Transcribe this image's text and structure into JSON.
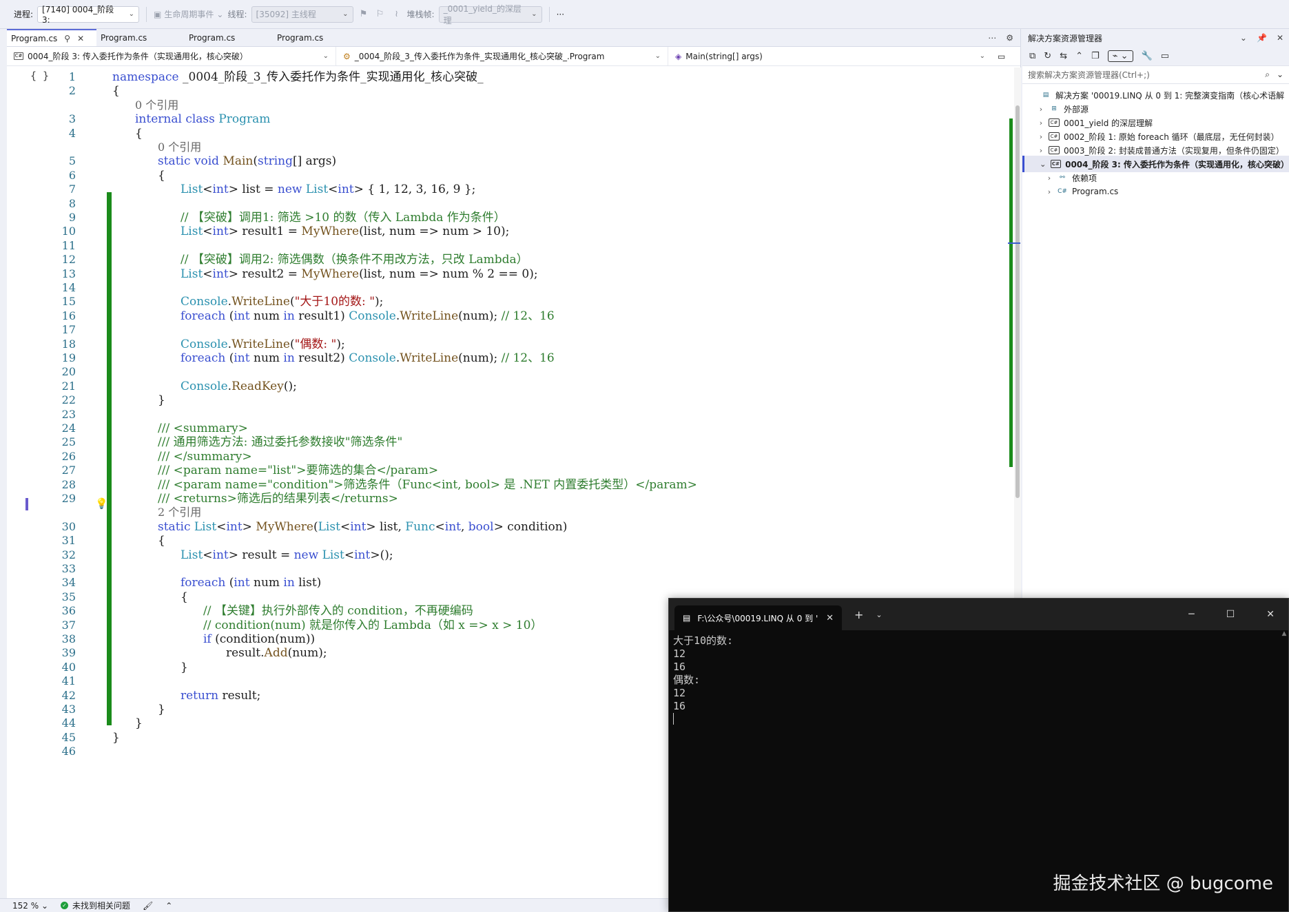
{
  "toolbar": {
    "process_label": "进程:",
    "process_value": "[7140] 0004_阶段 3:",
    "lifecycle_label": "生命周期事件",
    "thread_label": "线程:",
    "thread_value": "[35092] 主线程",
    "stackframe_label": "堆栈帧:",
    "stackframe_value": "_0001_yield_的深层理",
    "more": "···"
  },
  "tabs": [
    {
      "label": "Program.cs",
      "pin": "⚲",
      "close": "✕"
    },
    {
      "label": "Program.cs"
    },
    {
      "label": "Program.cs"
    },
    {
      "label": "Program.cs"
    }
  ],
  "navbar": {
    "project": "0004_阶段 3: 传入委托作为条件（实现通用化，核心突破）",
    "class": "_0004_阶段_3_传入委托作为条件_实现通用化_核心突破_.Program",
    "member": "Main(string[] args)"
  },
  "code_lines": [
    {
      "n": "1",
      "html": "<span class=\"kw\">namespace</span> _0004_阶段_3_传入委托作为条件_实现通用化_核心突破_",
      "indent": 0
    },
    {
      "n": "2",
      "html": "{",
      "indent": 0
    },
    {
      "n": "",
      "html": "<span class=\"ref\">0 个引用</span>",
      "indent": 1
    },
    {
      "n": "3",
      "html": "<span class=\"kw\">internal class</span> <span class=\"ty\">Program</span>",
      "indent": 1
    },
    {
      "n": "4",
      "html": "{",
      "indent": 1
    },
    {
      "n": "",
      "html": "<span class=\"ref\">0 个引用</span>",
      "indent": 2
    },
    {
      "n": "5",
      "html": "<span class=\"kw\">static void</span> <span class=\"mt\">Main</span>(<span class=\"kw\">string</span>[] args)",
      "indent": 2
    },
    {
      "n": "6",
      "html": "{",
      "indent": 2
    },
    {
      "n": "7",
      "html": "<span class=\"ty\">List</span>&lt;<span class=\"kw\">int</span>&gt; list = <span class=\"kw\">new</span> <span class=\"ty\">List</span>&lt;<span class=\"kw\">int</span>&gt; { 1, 12, 3, 16, 9 };",
      "indent": 3
    },
    {
      "n": "8",
      "html": "",
      "indent": 3
    },
    {
      "n": "9",
      "html": "<span class=\"cm\">// 【突破】调用1: 筛选 &gt;10 的数（传入 Lambda 作为条件）</span>",
      "indent": 3
    },
    {
      "n": "10",
      "html": "<span class=\"ty\">List</span>&lt;<span class=\"kw\">int</span>&gt; result1 = <span class=\"mt\">MyWhere</span>(list, num =&gt; num &gt; 10);",
      "indent": 3
    },
    {
      "n": "11",
      "html": "",
      "indent": 3
    },
    {
      "n": "12",
      "html": "<span class=\"cm\">// 【突破】调用2: 筛选偶数（换条件不用改方法，只改 Lambda）</span>",
      "indent": 3
    },
    {
      "n": "13",
      "html": "<span class=\"ty\">List</span>&lt;<span class=\"kw\">int</span>&gt; result2 = <span class=\"mt\">MyWhere</span>(list, num =&gt; num % 2 == 0);",
      "indent": 3
    },
    {
      "n": "14",
      "html": "",
      "indent": 3
    },
    {
      "n": "15",
      "html": "<span class=\"ty\">Console</span>.<span class=\"mt\">WriteLine</span>(<span class=\"st\">\"大于10的数: \"</span>);",
      "indent": 3
    },
    {
      "n": "16",
      "html": "<span class=\"kw\">foreach</span> (<span class=\"kw\">int</span> num <span class=\"kw\">in</span> result1) <span class=\"ty\">Console</span>.<span class=\"mt\">WriteLine</span>(num); <span class=\"cm\">// 12、16</span>",
      "indent": 3
    },
    {
      "n": "17",
      "html": "",
      "indent": 3
    },
    {
      "n": "18",
      "html": "<span class=\"ty\">Console</span>.<span class=\"mt\">WriteLine</span>(<span class=\"st\">\"偶数: \"</span>);",
      "indent": 3
    },
    {
      "n": "19",
      "html": "<span class=\"kw\">foreach</span> (<span class=\"kw\">int</span> num <span class=\"kw\">in</span> result2) <span class=\"ty\">Console</span>.<span class=\"mt\">WriteLine</span>(num); <span class=\"cm\">// 12、16</span>",
      "indent": 3
    },
    {
      "n": "20",
      "html": "",
      "indent": 3
    },
    {
      "n": "21",
      "html": "<span class=\"ty\">Console</span>.<span class=\"mt\">ReadKey</span>();",
      "indent": 3
    },
    {
      "n": "22",
      "html": "}",
      "indent": 2
    },
    {
      "n": "23",
      "html": "",
      "indent": 2
    },
    {
      "n": "24",
      "html": "<span class=\"cm\">/// &lt;summary&gt;</span>",
      "indent": 2
    },
    {
      "n": "25",
      "html": "<span class=\"cm\">/// 通用筛选方法: 通过委托参数接收\"筛选条件\"</span>",
      "indent": 2
    },
    {
      "n": "26",
      "html": "<span class=\"cm\">/// &lt;/summary&gt;</span>",
      "indent": 2
    },
    {
      "n": "27",
      "html": "<span class=\"cm\">/// &lt;param name=\"list\"&gt;要筛选的集合&lt;/param&gt;</span>",
      "indent": 2
    },
    {
      "n": "28",
      "html": "<span class=\"cm\">/// &lt;param name=\"condition\"&gt;筛选条件（Func&lt;int, bool&gt; 是 .NET 内置委托类型）&lt;/param&gt;</span>",
      "indent": 2
    },
    {
      "n": "29",
      "html": "<span class=\"cm\">/// &lt;returns&gt;筛选后的结果列表&lt;/returns&gt;</span>",
      "indent": 2
    },
    {
      "n": "",
      "html": "<span class=\"ref\">2 个引用</span>",
      "indent": 2
    },
    {
      "n": "30",
      "html": "<span class=\"kw\">static</span> <span class=\"ty\">List</span>&lt;<span class=\"kw\">int</span>&gt; <span class=\"mt\">MyWhere</span>(<span class=\"ty\">List</span>&lt;<span class=\"kw\">int</span>&gt; list, <span class=\"ty\">Func</span>&lt;<span class=\"kw\">int</span>, <span class=\"kw\">bool</span>&gt; condition)",
      "indent": 2
    },
    {
      "n": "31",
      "html": "{",
      "indent": 2
    },
    {
      "n": "32",
      "html": "<span class=\"ty\">List</span>&lt;<span class=\"kw\">int</span>&gt; result = <span class=\"kw\">new</span> <span class=\"ty\">List</span>&lt;<span class=\"kw\">int</span>&gt;();",
      "indent": 3
    },
    {
      "n": "33",
      "html": "",
      "indent": 3
    },
    {
      "n": "34",
      "html": "<span class=\"kw\">foreach</span> (<span class=\"kw\">int</span> num <span class=\"kw\">in</span> list)",
      "indent": 3
    },
    {
      "n": "35",
      "html": "{",
      "indent": 3
    },
    {
      "n": "36",
      "html": "<span class=\"cm\">// 【关键】执行外部传入的 condition，不再硬编码</span>",
      "indent": 4
    },
    {
      "n": "37",
      "html": "<span class=\"cm\">// condition(num) 就是你传入的 Lambda（如 x =&gt; x &gt; 10）</span>",
      "indent": 4
    },
    {
      "n": "38",
      "html": "<span class=\"kw\">if</span> (condition(num))",
      "indent": 4
    },
    {
      "n": "39",
      "html": "result.<span class=\"mt\">Add</span>(num);",
      "indent": 5
    },
    {
      "n": "40",
      "html": "}",
      "indent": 3
    },
    {
      "n": "41",
      "html": "",
      "indent": 3
    },
    {
      "n": "42",
      "html": "<span class=\"kw\">return</span> result;",
      "indent": 3
    },
    {
      "n": "43",
      "html": "}",
      "indent": 2
    },
    {
      "n": "44",
      "html": "}",
      "indent": 1
    },
    {
      "n": "45",
      "html": "}",
      "indent": 0
    },
    {
      "n": "46",
      "html": "",
      "indent": 0
    }
  ],
  "status": {
    "zoom": "152 %",
    "issues": "未找到相关问题"
  },
  "solution_explorer": {
    "title": "解决方案资源管理器",
    "search_placeholder": "搜索解决方案资源管理器(Ctrl+;)",
    "items": [
      {
        "label": "解决方案 '00019.LINQ 从 0 到 1: 完整演变指南（核心术语解",
        "icon": "solution-icon",
        "level": 0,
        "expander": ""
      },
      {
        "label": "外部源",
        "icon": "external-sources-icon",
        "level": 1,
        "expander": "›"
      },
      {
        "label": "0001_yield 的深层理解",
        "icon": "project-icon",
        "level": 1,
        "expander": "›"
      },
      {
        "label": "0002_阶段 1: 原始 foreach 循环（最底层，无任何封装）",
        "icon": "project-icon",
        "level": 1,
        "expander": "›"
      },
      {
        "label": "0003_阶段 2: 封装成普通方法（实现复用，但条件仍固定）",
        "icon": "project-icon",
        "level": 1,
        "expander": "›"
      },
      {
        "label": "0004_阶段 3: 传入委托作为条件（实现通用化，核心突破）",
        "icon": "project-icon",
        "level": 1,
        "expander": "⌄",
        "selected": true
      },
      {
        "label": "依赖项",
        "icon": "dependencies-icon",
        "level": 2,
        "expander": "›"
      },
      {
        "label": "Program.cs",
        "icon": "csharp-file-icon",
        "level": 2,
        "expander": "›"
      }
    ]
  },
  "console": {
    "tab_title": "F:\\公众号\\00019.LINQ 从 0 到 '",
    "output": [
      "大于10的数:",
      "12",
      "16",
      "偶数:",
      "12",
      "16"
    ],
    "watermark": "掘金技术社区 @ bugcome"
  }
}
